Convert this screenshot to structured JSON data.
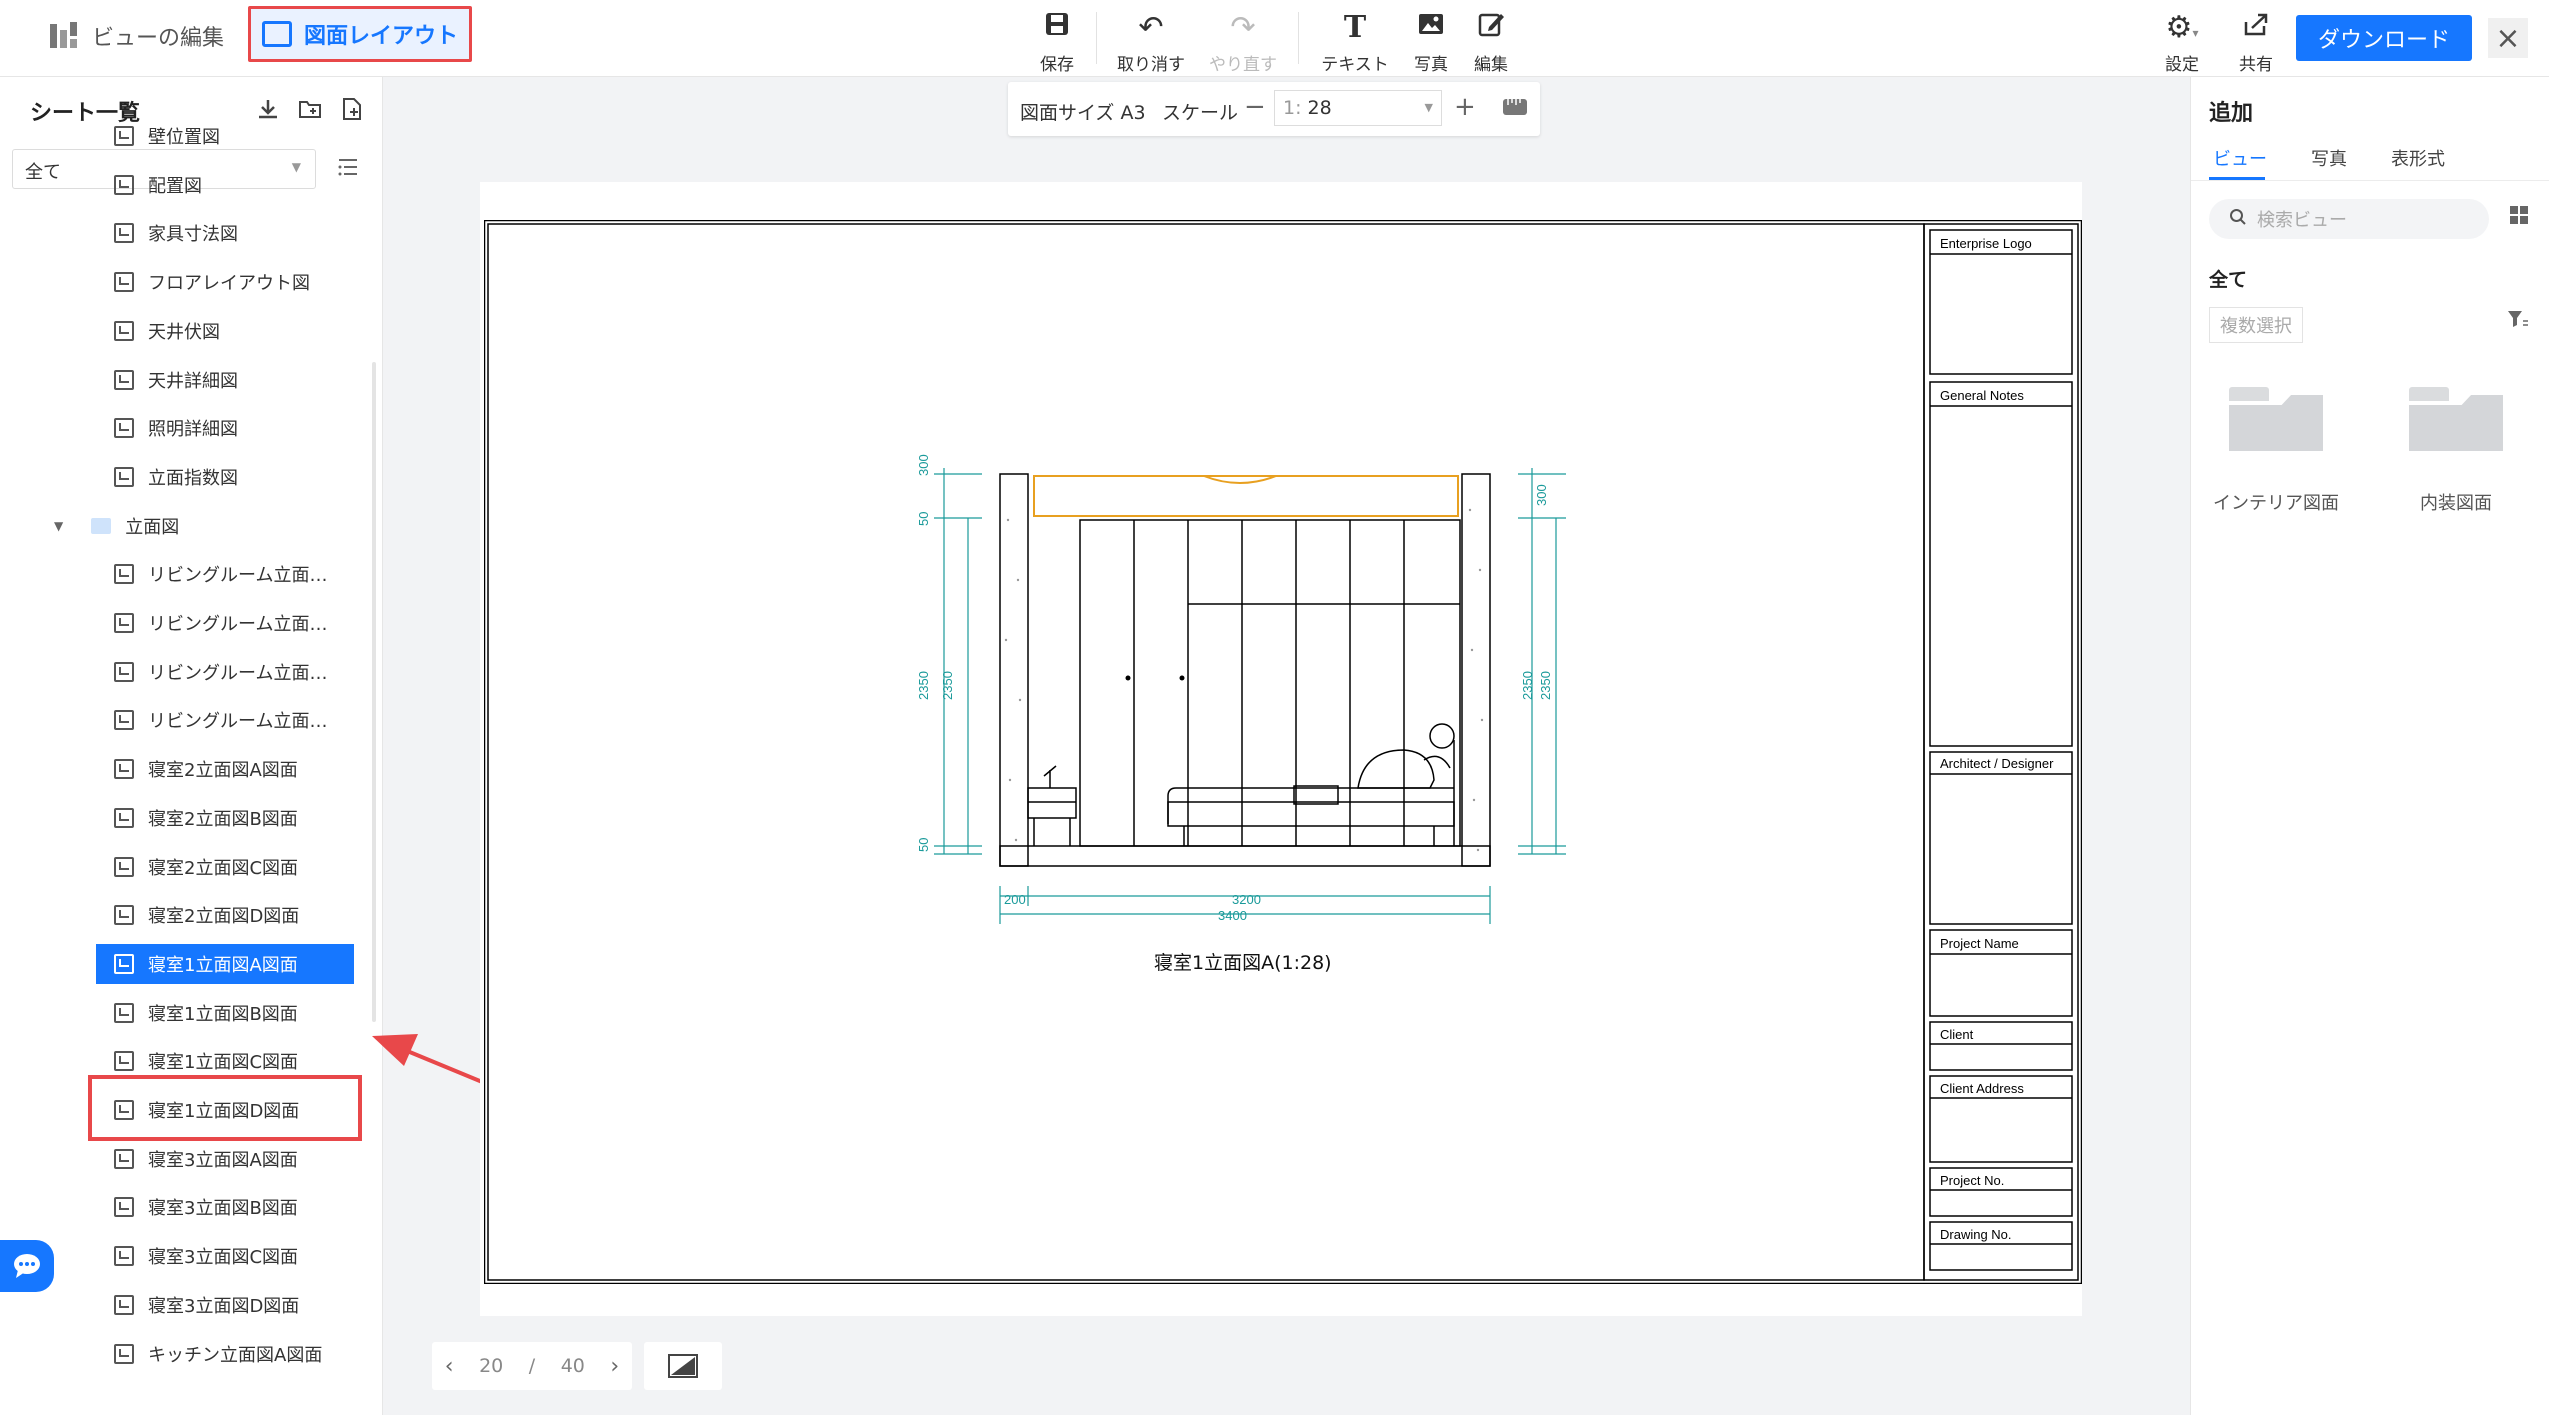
{
  "header": {
    "mode_edit": "ビューの編集",
    "mode_layout": "図面レイアウト",
    "tools": [
      {
        "icon": "save-icon",
        "label": "保存"
      },
      {
        "icon": "undo-icon",
        "label": "取り消す"
      },
      {
        "icon": "redo-icon",
        "label": "やり直す"
      },
      {
        "icon": "text-icon",
        "label": "テキスト"
      },
      {
        "icon": "photo-icon",
        "label": "写真"
      },
      {
        "icon": "edit-icon",
        "label": "編集"
      }
    ],
    "settings_label": "設定",
    "share_label": "共有",
    "download_label": "ダウンロード"
  },
  "sidebar": {
    "title": "シート一覧",
    "filter_value": "全て",
    "items": [
      "壁位置図",
      "配置図",
      "家具寸法図",
      "フロアレイアウト図",
      "天井伏図",
      "天井詳細図",
      "照明詳細図",
      "立面指数図"
    ],
    "folder": "立面図",
    "folder_items": [
      "リビングルーム立面…",
      "リビングルーム立面…",
      "リビングルーム立面…",
      "リビングルーム立面…",
      "寝室2立面図A図面",
      "寝室2立面図B図面",
      "寝室2立面図C図面",
      "寝室2立面図D図面",
      "寝室1立面図A図面",
      "寝室1立面図B図面",
      "寝室1立面図C図面",
      "寝室1立面図D図面",
      "寝室3立面図A図面",
      "寝室3立面図B図面",
      "寝室3立面図C図面",
      "寝室3立面図D図面",
      "キッチン立面図A図面"
    ],
    "selected_index": 8
  },
  "scalebar": {
    "paper_size": "図面サイズ A3",
    "scale_label": "スケール",
    "scale_prefix": "1:",
    "scale_value": "28"
  },
  "drawing": {
    "caption": "寝室1立面図A(1:28)",
    "dims": {
      "top": "300",
      "small": "50",
      "height": "2350",
      "left_width": "200",
      "inner_width": "3200",
      "total_width": "3400"
    }
  },
  "title_block": [
    "Enterprise Logo",
    "General Notes",
    "Architect / Designer",
    "Project Name",
    "Client",
    "Client Address",
    "Project No.",
    "Drawing No."
  ],
  "right_panel": {
    "title": "追加",
    "tabs": [
      "ビュー",
      "写真",
      "表形式"
    ],
    "search_placeholder": "検索ビュー",
    "all_label": "全て",
    "multi_select": "複数選択",
    "folders": [
      "インテリア図面",
      "内装図面"
    ]
  },
  "pager": {
    "current": "20",
    "separator": "/",
    "total": "40"
  },
  "colors": {
    "accent": "#1677ff",
    "highlight": "#e8484a",
    "dimension": "#1a9a9a",
    "light_fixture": "#e8a020"
  }
}
